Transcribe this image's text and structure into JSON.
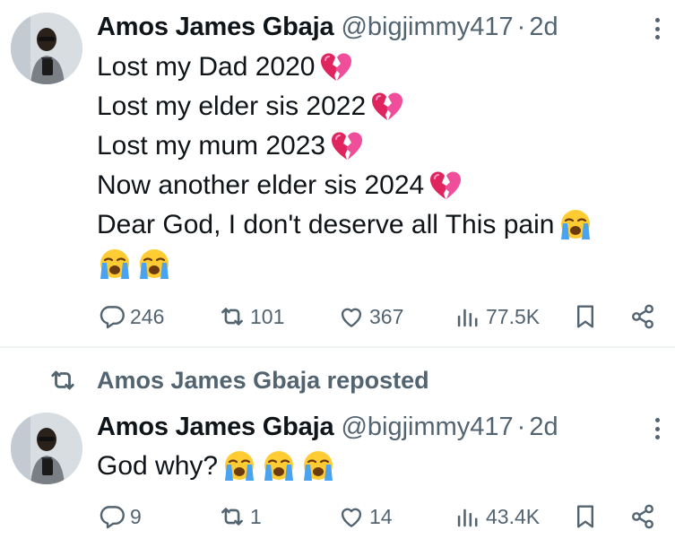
{
  "tweets": [
    {
      "author": {
        "name": "Amos James Gbaja",
        "handle": "@bigjimmy417",
        "time": "2d"
      },
      "lines": [
        {
          "text": "Lost my Dad 2020 ",
          "emoji": [
            "broken-heart-icon"
          ]
        },
        {
          "text": "Lost my elder sis 2022 ",
          "emoji": [
            "broken-heart-icon"
          ]
        },
        {
          "text": "Lost my mum 2023 ",
          "emoji": [
            "broken-heart-icon"
          ]
        },
        {
          "text": "Now another elder sis 2024 ",
          "emoji": [
            "broken-heart-icon"
          ]
        },
        {
          "text": "Dear God, I don't deserve all This pain ",
          "emoji": [
            "crying-face-icon"
          ]
        },
        {
          "text": "",
          "emoji": [
            "crying-face-icon",
            "crying-face-icon"
          ]
        }
      ],
      "stats": {
        "replies": "246",
        "reposts": "101",
        "likes": "367",
        "views": "77.5K"
      }
    },
    {
      "repost_label": "Amos James Gbaja reposted",
      "author": {
        "name": "Amos James Gbaja",
        "handle": "@bigjimmy417",
        "time": "2d"
      },
      "lines": [
        {
          "text": "God why? ",
          "emoji": [
            "crying-face-icon",
            "crying-face-icon",
            "crying-face-icon"
          ]
        }
      ],
      "stats": {
        "replies": "9",
        "reposts": "1",
        "likes": "14",
        "views": "43.4K"
      }
    }
  ],
  "separator": "·",
  "colors": {
    "text": "#0f1419",
    "secondary": "#536471",
    "divider": "#eff3f4",
    "heart": "#e0245e"
  }
}
